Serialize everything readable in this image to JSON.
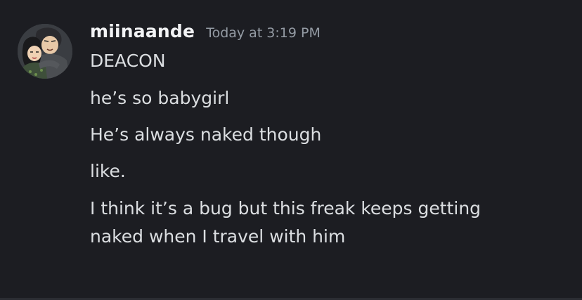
{
  "message": {
    "author": "miinaande",
    "timestamp": "Today at 3:19 PM",
    "lines": [
      "DEACON",
      "he’s so babygirl",
      "He’s always naked though",
      "like.",
      "I think it’s a bug but this freak keeps getting",
      "naked when I travel with him"
    ]
  },
  "colors": {
    "background": "#1c1d22",
    "username": "#f2f3f5",
    "timestamp": "#949ba4",
    "message_text": "#dbdee1"
  },
  "icons": {
    "avatar": "user-avatar-illustration"
  }
}
